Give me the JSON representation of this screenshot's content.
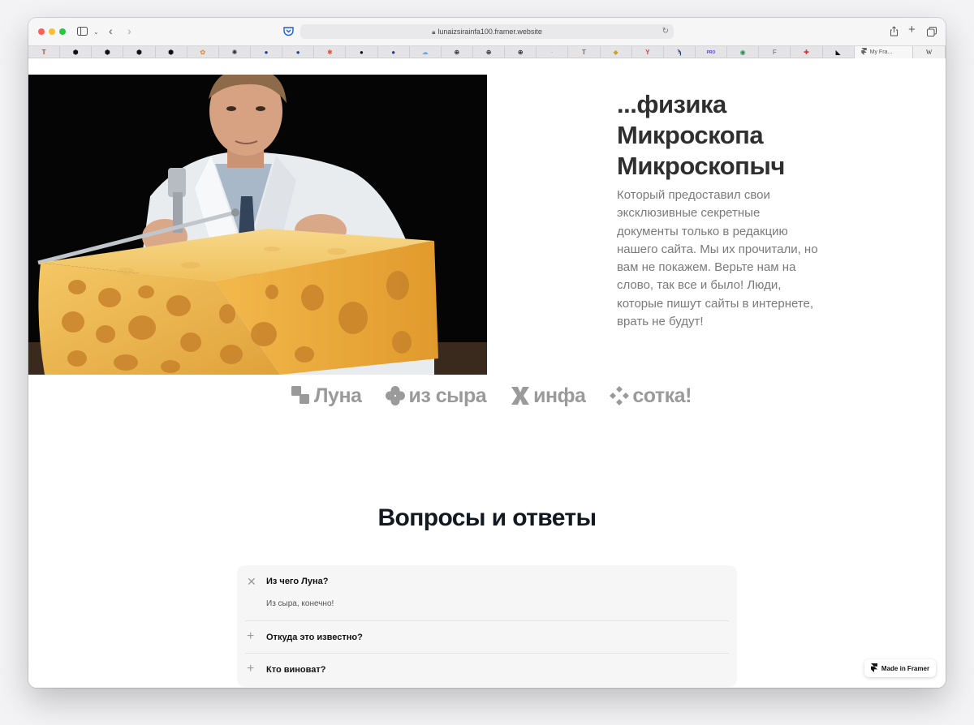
{
  "browser": {
    "url": "lunaizsirainfa100.framer.website",
    "active_tab_title": "My Fra...",
    "last_tab_label": "W",
    "tabs": [
      {
        "glyph": "T",
        "color": "#c0392b"
      },
      {
        "glyph": "⬢",
        "color": "#111111"
      },
      {
        "glyph": "⬢",
        "color": "#111111"
      },
      {
        "glyph": "⬢",
        "color": "#111111"
      },
      {
        "glyph": "⬢",
        "color": "#111111"
      },
      {
        "glyph": "✿",
        "color": "#e67e22"
      },
      {
        "glyph": "✺",
        "color": "#333333"
      },
      {
        "glyph": "●",
        "color": "#1f3a93"
      },
      {
        "glyph": "●",
        "color": "#1f3a93"
      },
      {
        "glyph": "✱",
        "color": "#e74c3c"
      },
      {
        "glyph": "●",
        "color": "#111111"
      },
      {
        "glyph": "●",
        "color": "#1f3a93"
      },
      {
        "glyph": "☁",
        "color": "#6fa8dc"
      },
      {
        "glyph": "⊕",
        "color": "#111111"
      },
      {
        "glyph": "⊕",
        "color": "#111111"
      },
      {
        "glyph": "⊕",
        "color": "#111111"
      },
      {
        "glyph": "·",
        "color": "#bbbbbb"
      },
      {
        "glyph": "T",
        "color": "#e53935"
      },
      {
        "glyph": "◆",
        "color": "#c9a227"
      },
      {
        "glyph": "Y",
        "color": "#e53935"
      },
      {
        "glyph": "ϡ",
        "color": "#1f3a93"
      },
      {
        "glyph": "PRO",
        "color": "#5b3fd1"
      },
      {
        "glyph": "◉",
        "color": "#2e8b57"
      },
      {
        "glyph": "F",
        "color": "#888888"
      },
      {
        "glyph": "✚",
        "color": "#d32f2f"
      },
      {
        "glyph": "◣",
        "color": "#111111"
      }
    ]
  },
  "hero": {
    "title_lines": [
      "...физика",
      "Микроскопа",
      "Микроскопыч"
    ],
    "description": "Который предоставил свои эксклюзивные секретные документы только в редакцию нашего сайта. Мы их прочитали, но вам не покажем. Верьте нам на слово, так все и было! Люди, которые пишут сайты в интернете, врать не будут!"
  },
  "logos": [
    {
      "label": "Луна",
      "icon": "blocks-icon"
    },
    {
      "label": "из сыра",
      "icon": "clover-icon"
    },
    {
      "label": "инфа",
      "icon": "x-blades-icon"
    },
    {
      "label": "сотка!",
      "icon": "diamonds-icon"
    }
  ],
  "faq": {
    "title": "Вопросы и ответы",
    "items": [
      {
        "question": "Из чего Луна?",
        "answer": "Из сыра, конечно!",
        "expanded": true
      },
      {
        "question": "Откуда это известно?",
        "answer": "",
        "expanded": false
      },
      {
        "question": "Кто виноват?",
        "answer": "",
        "expanded": false
      }
    ]
  },
  "badge": {
    "label": "Made in Framer"
  },
  "colors": {
    "title": "#2f2f2f",
    "body_text": "#7a7a7a",
    "logos": "#9a9a9a",
    "faq_heading": "#141821",
    "faq_bg": "#f6f6f6",
    "traffic_red": "#ff5f57",
    "traffic_yellow": "#febc2e",
    "traffic_green": "#28c840"
  }
}
